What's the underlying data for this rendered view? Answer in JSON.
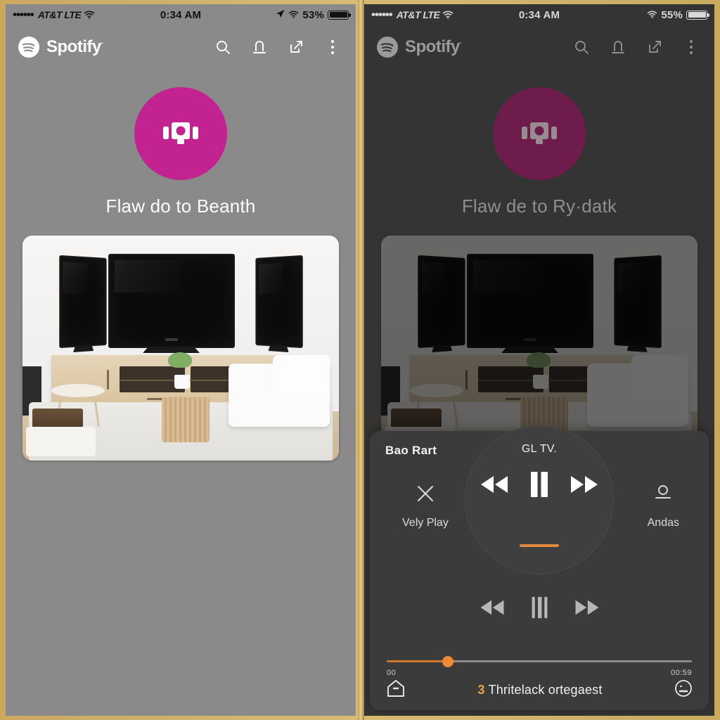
{
  "theme": {
    "border_color": "#c9a95e",
    "left_bg": "#8a8a8a",
    "right_bg": "#343434",
    "accent_magenta": "#c32391",
    "accent_magenta_dim": "#6d1c4b",
    "accent_orange": "#f08a35"
  },
  "left_panel": {
    "statusbar": {
      "signal_dots": "••••••",
      "carrier": "AT&T LTE",
      "wifi_icon": "wifi-icon",
      "time": "0:34 AM",
      "location_icon": "location-arrow-icon",
      "battery_percent": "53%"
    },
    "appbar": {
      "brand": "Spotify",
      "registered_mark": "·",
      "actions": [
        {
          "name": "search-icon",
          "label": "Search"
        },
        {
          "name": "download-icon",
          "label": "Download"
        },
        {
          "name": "share-icon",
          "label": "Share"
        },
        {
          "name": "overflow-menu-icon",
          "label": "More"
        }
      ]
    },
    "hero": {
      "icon": "cast-device-icon",
      "title": "Flaw do to Beanth"
    },
    "photo": {
      "alt": "living-room-with-three-tvs"
    }
  },
  "right_panel": {
    "statusbar": {
      "signal_dots": "••••••",
      "carrier": "AT&T LTE",
      "wifi_icon": "wifi-icon",
      "time": "0:34 AM",
      "battery_percent": "55%"
    },
    "appbar": {
      "brand": "Spotify",
      "registered_mark": "·",
      "actions": [
        {
          "name": "search-icon",
          "label": "Search"
        },
        {
          "name": "download-icon",
          "label": "Download"
        },
        {
          "name": "share-icon",
          "label": "Share"
        },
        {
          "name": "overflow-menu-icon",
          "label": "More"
        }
      ]
    },
    "hero": {
      "icon": "cast-device-icon",
      "title": "Flaw de to Ry·datk"
    },
    "overlay": {
      "title": "Bao Rart",
      "dial": {
        "label": "GL TV.",
        "rewind_icon": "rewind-icon",
        "pause_icon": "pause-icon",
        "forward_icon": "fast-forward-icon",
        "indicator_color": "#e08a3c"
      },
      "left_action": {
        "icon": "close-x-icon",
        "label": "Vely Play"
      },
      "right_action": {
        "icon": "person-icon",
        "label": "Andas"
      },
      "lower_controls": [
        {
          "name": "rewind-icon",
          "label": "Rewind"
        },
        {
          "name": "pause-icon",
          "label": "Pause"
        },
        {
          "name": "fast-forward-icon",
          "label": "Fast forward"
        }
      ],
      "seek": {
        "start_time": "00",
        "end_time": "00:59",
        "progress_percent": 20
      },
      "bottom": {
        "home_icon": "home-icon",
        "track_number": "3",
        "track_label": "Thritelack ortegaest",
        "face_icon": "face-icon"
      }
    }
  }
}
